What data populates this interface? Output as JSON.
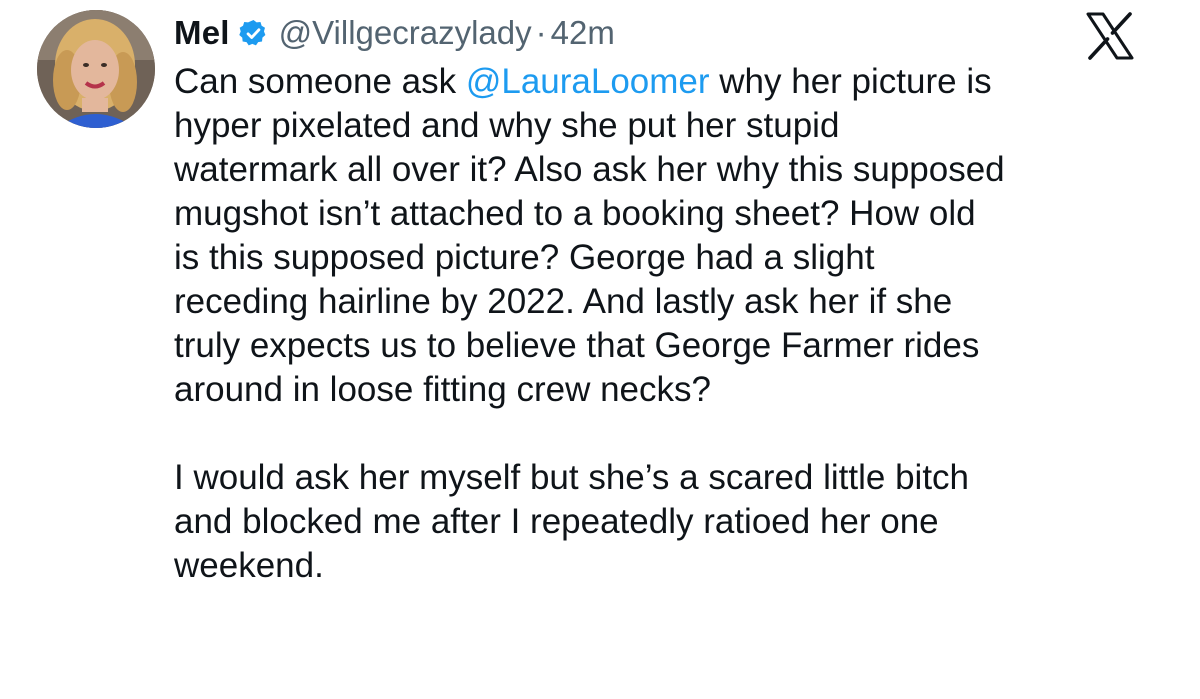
{
  "author": {
    "name": "Mel",
    "handle": "@Villgecrazylady",
    "separator": "·",
    "time": "42m",
    "verified": true
  },
  "brand": {
    "logo_icon": "x-logo-icon"
  },
  "tweet": {
    "lines": [
      {
        "before": "Can someone ask ",
        "mention": "@LauraLoomer",
        "after": " why her picture is"
      },
      {
        "text": "hyper pixelated and why she put her stupid"
      },
      {
        "text": "watermark all over it? Also ask her why this supposed"
      },
      {
        "text": "mugshot isn’t attached to a booking sheet? How old"
      },
      {
        "text": "is this supposed picture? George had a slight"
      },
      {
        "text": "receding hairline by 2022. And lastly ask her if she"
      },
      {
        "text": "truly expects us to believe that George Farmer rides"
      },
      {
        "text": "around in loose fitting crew necks?"
      },
      {
        "text": ""
      },
      {
        "text": "I would ask her myself but she’s a scared little bitch"
      },
      {
        "text": "and blocked me after I repeatedly ratioed her one"
      },
      {
        "text": "weekend."
      }
    ]
  },
  "colors": {
    "text": "#0f1419",
    "secondary": "#536471",
    "link": "#1d9bf0",
    "verified_badge": "#1d9bf0"
  }
}
